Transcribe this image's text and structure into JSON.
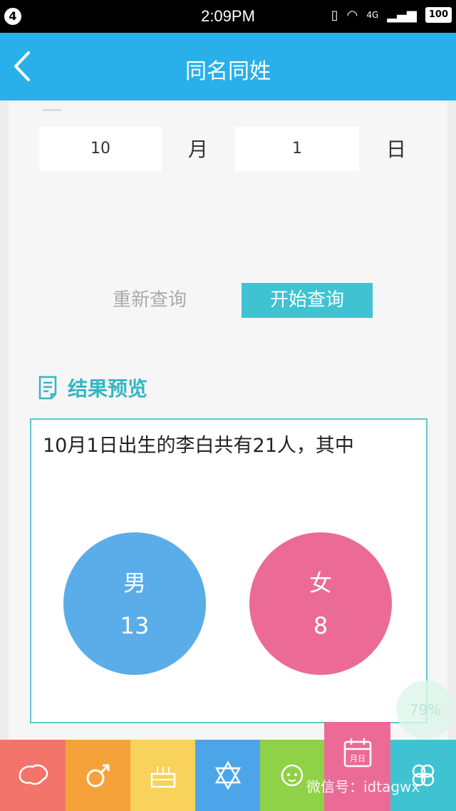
{
  "status": {
    "badge": "4",
    "time": "2:09PM",
    "network": "4G",
    "battery": "100"
  },
  "header": {
    "title": "同名同姓"
  },
  "date": {
    "month_value": "10",
    "month_unit": "月",
    "day_value": "1",
    "day_unit": "日"
  },
  "actions": {
    "reset_label": "重新查询",
    "start_label": "开始查询"
  },
  "result": {
    "section_title": "结果预览",
    "summary": "10月1日出生的李白共有21人，其中",
    "male_label": "男",
    "male_count": "13",
    "female_label": "女",
    "female_count": "8"
  },
  "progress": "79%",
  "colors": {
    "header": "#29b0ea",
    "accent": "#3fc3d2",
    "male": "#5aade8",
    "female": "#ec6b96"
  },
  "tabs": [
    {
      "icon": "china-map-icon",
      "color": "#f2746b"
    },
    {
      "icon": "gender-male-icon",
      "color": "#f6a23a"
    },
    {
      "icon": "birthday-cake-icon",
      "color": "#f8d25a"
    },
    {
      "icon": "star-of-david-icon",
      "color": "#4da5e9"
    },
    {
      "icon": "sheep-icon",
      "color": "#8fd147"
    },
    {
      "icon": "calendar-icon",
      "label": "月日",
      "color": "#ec6b96"
    },
    {
      "icon": "clover-icon",
      "color": "#3fc3d2"
    }
  ],
  "watermark": "微信号：idtagwx"
}
